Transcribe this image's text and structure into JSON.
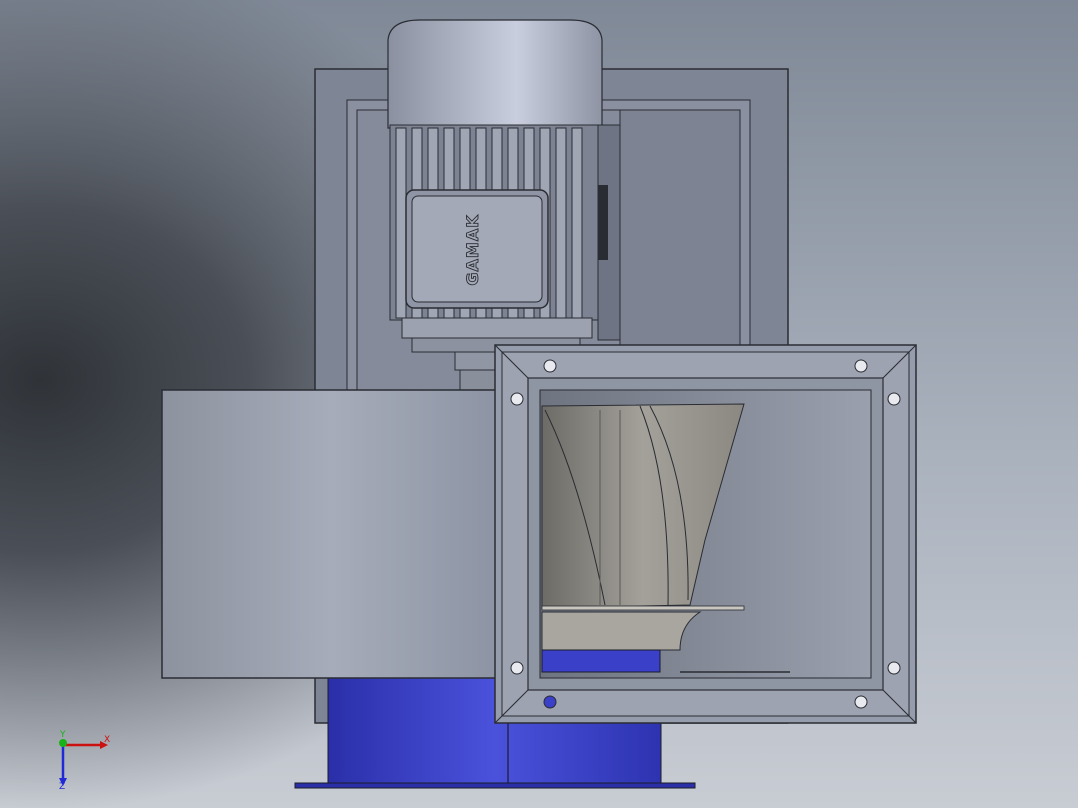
{
  "viewport": {
    "model_brand": "GAMAK",
    "triad": {
      "x_label": "X",
      "y_label": "Y",
      "z_label": "Z"
    }
  },
  "colors": {
    "steel": "#8f96a6",
    "steel_dark": "#6b7282",
    "motor": "#9ea5b5",
    "base_blue": "#3a40c8",
    "edge": "#2a2c33"
  }
}
